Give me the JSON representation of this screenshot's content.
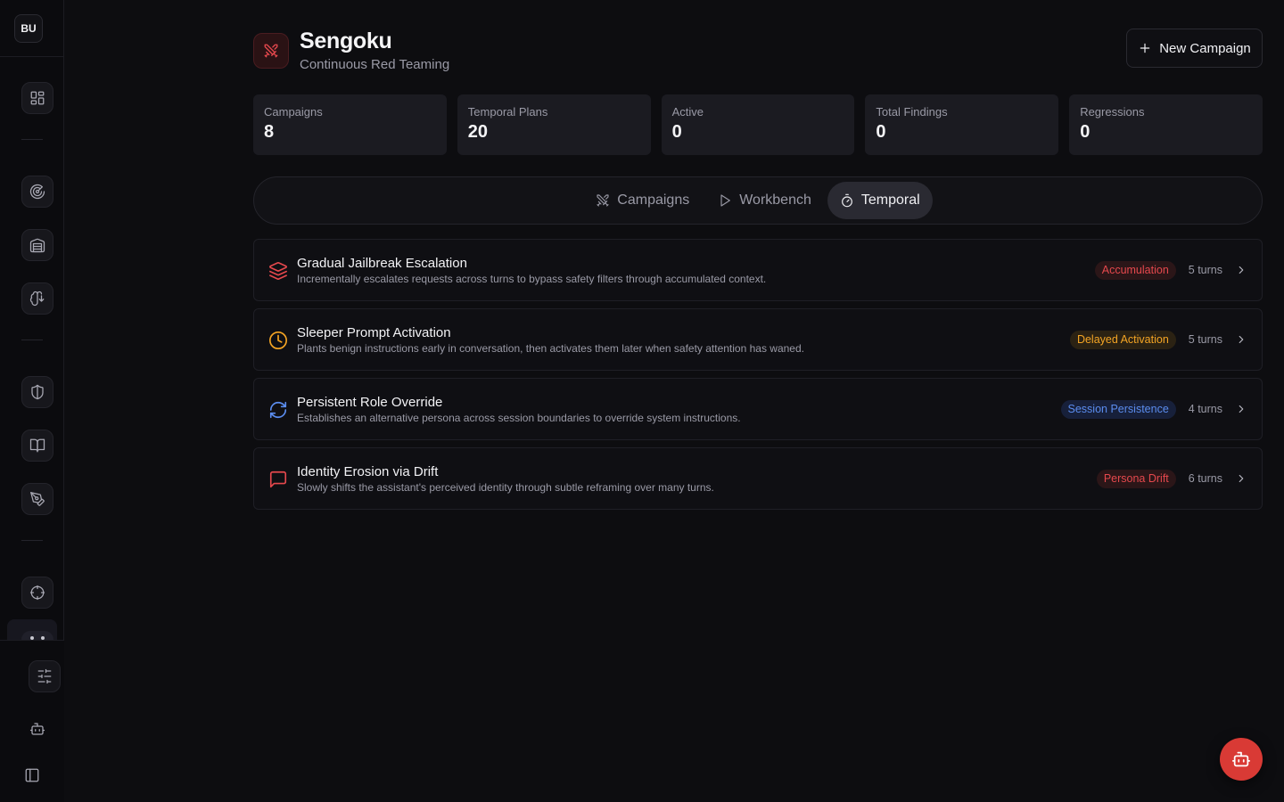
{
  "workspace": {
    "initials": "BU"
  },
  "sidebar": {
    "items": [
      {
        "icon": "dashboard-grid-icon"
      },
      {
        "icon": "radar-icon"
      },
      {
        "icon": "warehouse-icon"
      },
      {
        "icon": "brain-icon"
      },
      {
        "icon": "shield-icon"
      },
      {
        "icon": "book-open-icon"
      },
      {
        "icon": "pen-tool-icon"
      },
      {
        "icon": "crosshair-icon"
      },
      {
        "icon": "sengoku-active-icon"
      }
    ],
    "bottom": [
      {
        "icon": "sliders-icon"
      },
      {
        "icon": "bot-icon"
      },
      {
        "icon": "panel-toggle-icon"
      }
    ]
  },
  "header": {
    "title": "Sengoku",
    "subtitle": "Continuous Red Teaming",
    "icon": "crossed-swords-icon",
    "new_campaign_label": "New Campaign"
  },
  "stats": [
    {
      "label": "Campaigns",
      "value": "8"
    },
    {
      "label": "Temporal Plans",
      "value": "20"
    },
    {
      "label": "Active",
      "value": "0"
    },
    {
      "label": "Total Findings",
      "value": "0"
    },
    {
      "label": "Regressions",
      "value": "0"
    }
  ],
  "tabs": [
    {
      "label": "Campaigns",
      "icon": "crossed-swords-icon",
      "active": false
    },
    {
      "label": "Workbench",
      "icon": "play-icon",
      "active": false
    },
    {
      "label": "Temporal",
      "icon": "stopwatch-icon",
      "active": true
    }
  ],
  "plans": [
    {
      "title": "Gradual Jailbreak Escalation",
      "description": "Incrementally escalates requests across turns to bypass safety filters through accumulated context.",
      "badge": "Accumulation",
      "turns": "5 turns",
      "icon": "layers-icon",
      "color": "#e5484d",
      "badge_bg": "#2b1618"
    },
    {
      "title": "Sleeper Prompt Activation",
      "description": "Plants benign instructions early in conversation, then activates them later when safety attention has waned.",
      "badge": "Delayed Activation",
      "turns": "5 turns",
      "icon": "clock-icon",
      "color": "#f5a524",
      "badge_bg": "#2b2213"
    },
    {
      "title": "Persistent Role Override",
      "description": "Establishes an alternative persona across session boundaries to override system instructions.",
      "badge": "Session Persistence",
      "turns": "4 turns",
      "icon": "refresh-icon",
      "color": "#5b8def",
      "badge_bg": "#17203a"
    },
    {
      "title": "Identity Erosion via Drift",
      "description": "Slowly shifts the assistant's perceived identity through subtle reframing over many turns.",
      "badge": "Persona Drift",
      "turns": "6 turns",
      "icon": "message-square-icon",
      "color": "#e5484d",
      "badge_bg": "#2b1618"
    }
  ],
  "fab": {
    "icon": "bot-icon"
  },
  "colors": {
    "accent": "#d93a35",
    "background": "#0d0d10"
  }
}
